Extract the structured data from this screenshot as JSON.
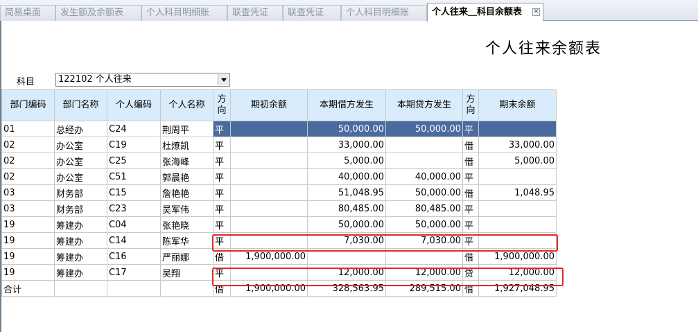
{
  "tabs": [
    {
      "label": "简易桌面"
    },
    {
      "label": "发生额及余额表"
    },
    {
      "label": "个人科目明细账"
    },
    {
      "label": "联查凭证"
    },
    {
      "label": "联查凭证"
    },
    {
      "label": "个人科目明细账"
    },
    {
      "label": "个人往来＿科目余额表",
      "active": true
    }
  ],
  "tab_close_glyph": "✕",
  "report": {
    "title": "个人往来余额表",
    "subject_label": "科目",
    "subject_value": "122102 个人往来"
  },
  "columns": [
    "部门编码",
    "部门名称",
    "个人编码",
    "个人名称",
    "方向",
    "期初余额",
    "本期借方发生",
    "本期贷方发生",
    "方向",
    "期末余额"
  ],
  "rows": [
    {
      "dept_code": "01",
      "dept_name": "总经办",
      "person_code": "C24",
      "person_name": "荆周平",
      "dir1": "平",
      "opening": "",
      "debit": "50,000.00",
      "credit": "50,000.00",
      "dir2": "平",
      "closing": ""
    },
    {
      "dept_code": "02",
      "dept_name": "办公室",
      "person_code": "C19",
      "person_name": "杜燎凯",
      "dir1": "平",
      "opening": "",
      "debit": "33,000.00",
      "credit": "",
      "dir2": "借",
      "closing": "33,000.00"
    },
    {
      "dept_code": "02",
      "dept_name": "办公室",
      "person_code": "C25",
      "person_name": "张海峰",
      "dir1": "平",
      "opening": "",
      "debit": "5,000.00",
      "credit": "",
      "dir2": "借",
      "closing": "5,000.00"
    },
    {
      "dept_code": "02",
      "dept_name": "办公室",
      "person_code": "C51",
      "person_name": "郭晨艳",
      "dir1": "平",
      "opening": "",
      "debit": "40,000.00",
      "credit": "40,000.00",
      "dir2": "平",
      "closing": ""
    },
    {
      "dept_code": "03",
      "dept_name": "财务部",
      "person_code": "C15",
      "person_name": "詹艳艳",
      "dir1": "平",
      "opening": "",
      "debit": "51,048.95",
      "credit": "50,000.00",
      "dir2": "借",
      "closing": "1,048.95"
    },
    {
      "dept_code": "03",
      "dept_name": "财务部",
      "person_code": "C23",
      "person_name": "吴军伟",
      "dir1": "平",
      "opening": "",
      "debit": "80,485.00",
      "credit": "80,485.00",
      "dir2": "平",
      "closing": ""
    },
    {
      "dept_code": "19",
      "dept_name": "筹建办",
      "person_code": "C04",
      "person_name": "张艳晓",
      "dir1": "平",
      "opening": "",
      "debit": "50,000.00",
      "credit": "50,000.00",
      "dir2": "平",
      "closing": ""
    },
    {
      "dept_code": "19",
      "dept_name": "筹建办",
      "person_code": "C14",
      "person_name": "陈军华",
      "dir1": "平",
      "opening": "",
      "debit": "7,030.00",
      "credit": "7,030.00",
      "dir2": "平",
      "closing": ""
    },
    {
      "dept_code": "19",
      "dept_name": "筹建办",
      "person_code": "C16",
      "person_name": "严丽娜",
      "dir1": "借",
      "opening": "1,900,000.00",
      "debit": "",
      "credit": "",
      "dir2": "借",
      "closing": "1,900,000.00"
    },
    {
      "dept_code": "19",
      "dept_name": "筹建办",
      "person_code": "C17",
      "person_name": "吴翔",
      "dir1": "平",
      "opening": "",
      "debit": "12,000.00",
      "credit": "12,000.00",
      "dir2": "贷",
      "closing": "12,000.00"
    },
    {
      "dept_code": "合计",
      "dept_name": "",
      "person_code": "",
      "person_name": "",
      "dir1": "借",
      "opening": "1,900,000.00",
      "debit": "328,563.95",
      "credit": "289,515.00",
      "dir2": "借",
      "closing": "1,927,048.95"
    }
  ],
  "colors": {
    "header_bg": "#d9ecfb",
    "selected_row_bg": "#4b6b9e",
    "highlight_border": "#e3262c"
  }
}
